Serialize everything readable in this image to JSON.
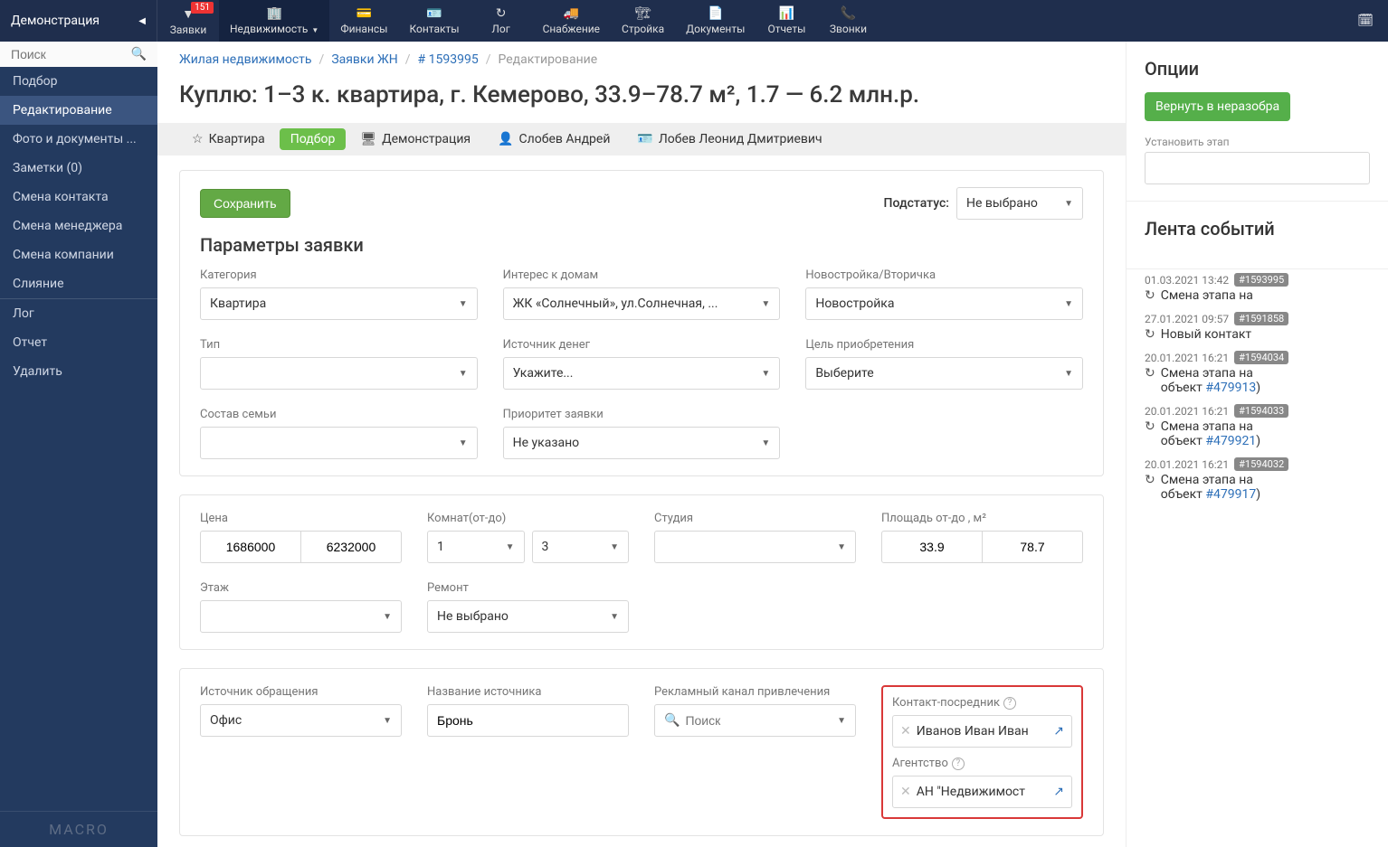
{
  "brand": "Демонстрация",
  "nav": [
    {
      "label": "Заявки",
      "badge": "151"
    },
    {
      "label": "Недвижимость",
      "dropdown": true
    },
    {
      "label": "Финансы"
    },
    {
      "label": "Контакты"
    },
    {
      "label": "Лог"
    },
    {
      "label": "Снабжение"
    },
    {
      "label": "Стройка"
    },
    {
      "label": "Документы"
    },
    {
      "label": "Отчеты"
    },
    {
      "label": "Звонки"
    }
  ],
  "search_placeholder": "Поиск",
  "side": [
    "Подбор",
    "Редактирование",
    "Фото и документы ...",
    "Заметки (0)",
    "Смена контакта",
    "Смена менеджера",
    "Смена компании",
    "Слияние",
    "Лог",
    "Отчет",
    "Удалить"
  ],
  "side_active_index": 1,
  "logo": "MACRO",
  "crumbs": [
    "Жилая недвижимость",
    "Заявки ЖН",
    "# 1593995",
    "Редактирование"
  ],
  "title": "Куплю: 1–3 к. квартира, г. Кемерово, 33.9–78.7 м², 1.7 — 6.2 млн.р.",
  "tabs": [
    {
      "label": "Квартира",
      "icon": "☆"
    },
    {
      "label": "Подбор",
      "pill": true
    },
    {
      "label": "Демонстрация",
      "icon": "🖥"
    },
    {
      "label": "Слобев Андрей",
      "icon": "👤"
    },
    {
      "label": "Лобев Леонид Дмитриевич",
      "icon": "🪪"
    }
  ],
  "save_label": "Сохранить",
  "substatus_label": "Подстатус:",
  "substatus_value": "Не выбрано",
  "section1_title": "Параметры заявки",
  "fields1": {
    "category": {
      "label": "Категория",
      "value": "Квартира"
    },
    "interest": {
      "label": "Интерес к домам",
      "value": "ЖК «Солнечный», ул.Солнечная, ..."
    },
    "newold": {
      "label": "Новостройка/Вторичка",
      "value": "Новостройка"
    },
    "type": {
      "label": "Тип",
      "value": ""
    },
    "money": {
      "label": "Источник денег",
      "value": "Укажите..."
    },
    "purpose": {
      "label": "Цель приобретения",
      "value": "Выберите"
    },
    "family": {
      "label": "Состав семьи",
      "value": ""
    },
    "priority": {
      "label": "Приоритет заявки",
      "value": "Не указано"
    }
  },
  "fields2": {
    "price_label": "Цена",
    "price_from": "1686000",
    "price_to": "6232000",
    "rooms_label": "Комнат(от-до)",
    "rooms_from": "1",
    "rooms_to": "3",
    "studio_label": "Студия",
    "studio_value": "",
    "area_label": "Площадь от-до , м²",
    "area_from": "33.9",
    "area_to": "78.7",
    "floor_label": "Этаж",
    "floor_value": "",
    "repair_label": "Ремонт",
    "repair_value": "Не выбрано"
  },
  "fields3": {
    "source_label": "Источник обращения",
    "source_value": "Офис",
    "srcname_label": "Название источника",
    "srcname_value": "Бронь",
    "adchannel_label": "Рекламный канал привлечения",
    "adchannel_placeholder": "Поиск",
    "contact_label": "Контакт-посредник",
    "contact_value": "Иванов Иван Иван",
    "agency_label": "Агентство",
    "agency_value": "АН \"Недвижимост"
  },
  "right": {
    "opt_title": "Опции",
    "return_btn": "Вернуть в неразобра",
    "set_stage_label": "Установить этап",
    "events_title": "Лента событий",
    "events": [
      {
        "ts": "01.03.2021 13:42",
        "tag": "#1593995",
        "text": "Смена этапа на"
      },
      {
        "ts": "27.01.2021 09:57",
        "tag": "#1591858",
        "text": "Новый контакт"
      },
      {
        "ts": "20.01.2021 16:21",
        "tag": "#1594034",
        "text": "Смена этапа на",
        "line2": "объект ",
        "link": "#479913",
        "close": ")"
      },
      {
        "ts": "20.01.2021 16:21",
        "tag": "#1594033",
        "text": "Смена этапа на",
        "line2": "объект ",
        "link": "#479921",
        "close": ")"
      },
      {
        "ts": "20.01.2021 16:21",
        "tag": "#1594032",
        "text": "Смена этапа на",
        "line2": "объект ",
        "link": "#479917",
        "close": ")"
      }
    ]
  }
}
